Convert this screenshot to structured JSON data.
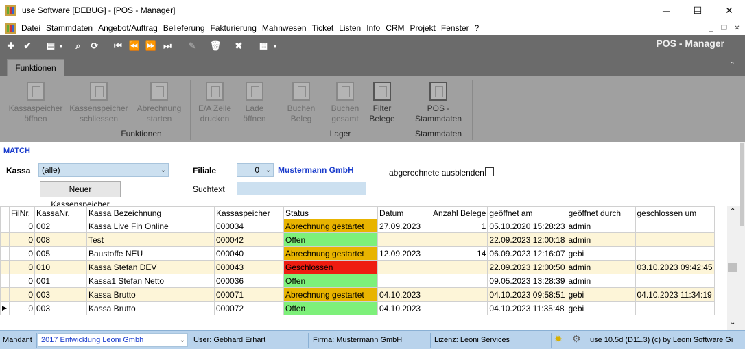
{
  "window": {
    "title": "use Software [DEBUG] - [POS - Manager]",
    "minimize": "─",
    "maximize": "☐",
    "close": "✕"
  },
  "menu": [
    "Datei",
    "Stammdaten",
    "Angebot/Auftrag",
    "Belieferung",
    "Fakturierung",
    "Mahnwesen",
    "Ticket",
    "Listen",
    "Info",
    "CRM",
    "Projekt",
    "Fenster",
    "?"
  ],
  "toolbar": {
    "screen_title": "POS - Manager"
  },
  "tab": {
    "label": "Funktionen"
  },
  "ribbon": {
    "buttons": [
      {
        "label1": "Kassaspeicher",
        "label2": "öffnen"
      },
      {
        "label1": "Kassenspeicher",
        "label2": "schliessen"
      },
      {
        "label1": "Abrechnung",
        "label2": "starten"
      },
      {
        "label1": "E/A Zeile",
        "label2": "drucken"
      },
      {
        "label1": "Lade",
        "label2": "öffnen"
      },
      {
        "label1": "Buchen",
        "label2": "Beleg"
      },
      {
        "label1": "Buchen",
        "label2": "gesamt"
      },
      {
        "label1": "Filter",
        "label2": "Belege"
      },
      {
        "label1": "POS -",
        "label2": "Stammdaten"
      }
    ],
    "groups": [
      "Funktionen",
      "Lager",
      "Stammdaten"
    ]
  },
  "filter": {
    "match_label": "MATCH",
    "kassa_label": "Kassa",
    "kassa_value": "(alle)",
    "new_button": "Neuer Kassenspeicher",
    "filiale_label": "Filiale",
    "filiale_value": "0",
    "filiale_name": "Mustermann GmbH",
    "suchtext_label": "Suchtext",
    "suchtext_value": "",
    "hide_label": "abgerechnete ausblenden"
  },
  "grid": {
    "columns": [
      "FilNr.",
      "KassaNr.",
      "Kassa Bezeichnung",
      "Kassaspeicher",
      "Status",
      "Datum",
      "Anzahl Belege",
      "geöffnet am",
      "geöffnet durch",
      "geschlossen um"
    ],
    "rows": [
      {
        "filnr": "0",
        "kassanr": "002",
        "bez": "Kassa Live Fin Online",
        "speicher": "000034",
        "status": "Abrechnung gestartet",
        "status_color": "orange",
        "datum": "27.09.2023",
        "belege": "1",
        "geoeffnet_am": "05.10.2020 15:28:23",
        "durch": "admin",
        "geschlossen": ""
      },
      {
        "filnr": "0",
        "kassanr": "008",
        "bez": "Test",
        "speicher": "000042",
        "status": "Offen",
        "status_color": "green",
        "datum": "",
        "belege": "",
        "geoeffnet_am": "22.09.2023 12:00:18",
        "durch": "admin",
        "geschlossen": ""
      },
      {
        "filnr": "0",
        "kassanr": "005",
        "bez": "Baustoffe NEU",
        "speicher": "000040",
        "status": "Abrechnung gestartet",
        "status_color": "orange",
        "datum": "12.09.2023",
        "belege": "14",
        "geoeffnet_am": "06.09.2023 12:16:07",
        "durch": "gebi",
        "geschlossen": ""
      },
      {
        "filnr": "0",
        "kassanr": "010",
        "bez": "Kassa Stefan DEV",
        "speicher": "000043",
        "status": "Geschlossen",
        "status_color": "red",
        "datum": "",
        "belege": "",
        "geoeffnet_am": "22.09.2023 12:00:50",
        "durch": "admin",
        "geschlossen": "03.10.2023 09:42:45"
      },
      {
        "filnr": "0",
        "kassanr": "001",
        "bez": "Kassa1 Stefan Netto",
        "speicher": "000036",
        "status": "Offen",
        "status_color": "green",
        "datum": "",
        "belege": "",
        "geoeffnet_am": "09.05.2023 13:28:39",
        "durch": "admin",
        "geschlossen": ""
      },
      {
        "filnr": "0",
        "kassanr": "003",
        "bez": "Kassa Brutto",
        "speicher": "000071",
        "status": "Abrechnung gestartet",
        "status_color": "orange",
        "datum": "04.10.2023",
        "belege": "",
        "geoeffnet_am": "04.10.2023 09:58:51",
        "durch": "gebi",
        "geschlossen": "04.10.2023 11:34:19"
      },
      {
        "filnr": "0",
        "kassanr": "003",
        "bez": "Kassa Brutto",
        "speicher": "000072",
        "status": "Offen",
        "status_color": "green",
        "datum": "04.10.2023",
        "belege": "",
        "geoeffnet_am": "04.10.2023 11:35:48",
        "durch": "gebi",
        "geschlossen": ""
      }
    ]
  },
  "status": {
    "mandant_label": "Mandant",
    "mandant_value": "2017  Entwicklung Leoni Gmbh",
    "user": "User: Gebhard Erhart",
    "firma": "Firma: Mustermann GmbH",
    "lizenz": "Lizenz: Leoni Services",
    "version": "use 10.5d (D11.3) (c) by Leoni Software Gi"
  }
}
